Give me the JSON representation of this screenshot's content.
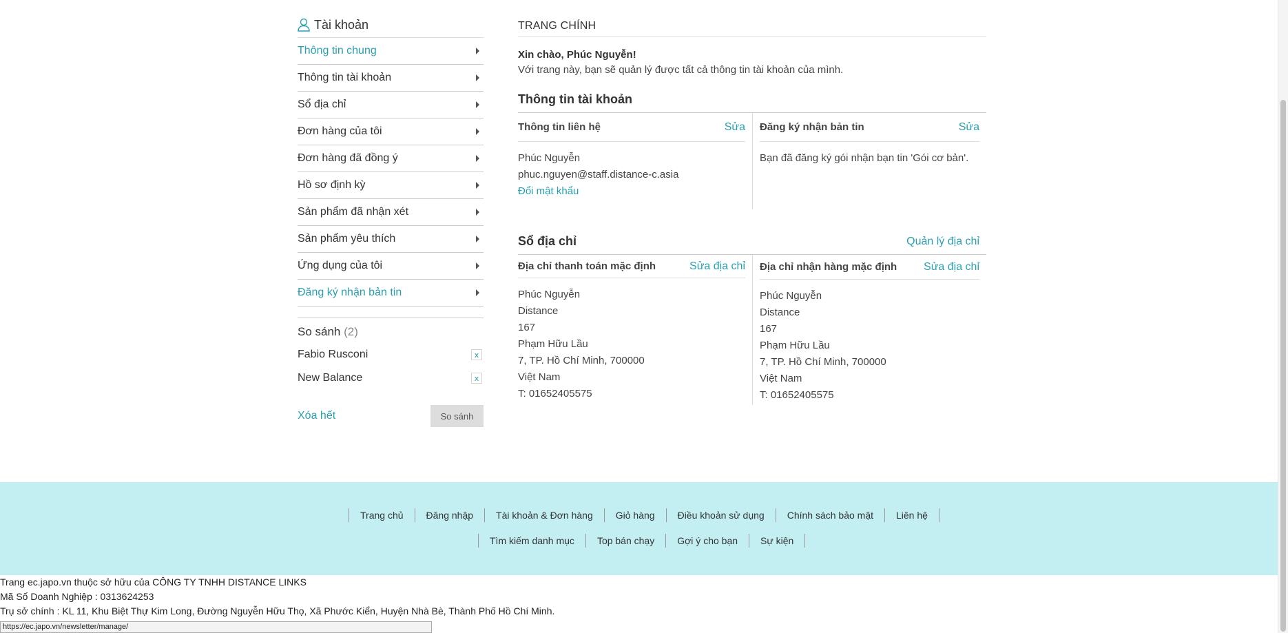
{
  "sidebar": {
    "title": "Tài khoản",
    "items": [
      {
        "label": "Thông tin chung",
        "active": true
      },
      {
        "label": "Thông tin tài khoản",
        "active": false
      },
      {
        "label": "Sổ địa chỉ",
        "active": false
      },
      {
        "label": "Đơn hàng của tôi",
        "active": false
      },
      {
        "label": "Đơn hàng đã đồng ý",
        "active": false
      },
      {
        "label": "Hồ sơ định kỳ",
        "active": false
      },
      {
        "label": "Sản phẩm đã nhận xét",
        "active": false
      },
      {
        "label": "Sản phẩm yêu thích",
        "active": false
      },
      {
        "label": "Ứng dụng của tôi",
        "active": false
      },
      {
        "label": "Đăng ký nhận bản tin",
        "active": true
      }
    ],
    "compare": {
      "title": "So sánh",
      "count": "(2)",
      "items": [
        "Fabio Rusconi",
        "New Balance"
      ],
      "remove_label": "x",
      "clear_label": "Xóa hết",
      "compare_button": "So sánh"
    }
  },
  "main": {
    "page_title": "TRANG CHÍNH",
    "greeting": "Xin chào, Phúc Nguyễn!",
    "greeting_sub": "Với trang này, bạn sẽ quản lý được tất cả thông tin tài khoản của mình.",
    "account_section": {
      "title": "Thông tin tài khoản",
      "contact": {
        "label": "Thông tin liên hệ",
        "edit": "Sửa",
        "name": "Phúc Nguyễn",
        "email": "phuc.nguyen@staff.distance-c.asia",
        "change_password": "Đổi mật khẩu"
      },
      "newsletter": {
        "label": "Đăng ký nhận bản tin",
        "edit": "Sửa",
        "text": "Bạn đã đăng ký gói nhận bạn tin 'Gói cơ bản'."
      }
    },
    "address_section": {
      "title": "Sổ địa chỉ",
      "manage": "Quản lý địa chỉ",
      "billing": {
        "label": "Địa chỉ thanh toán mặc định",
        "edit": "Sửa địa chỉ",
        "lines": [
          "Phúc Nguyễn",
          "Distance",
          "167",
          "Phạm Hữu Lầu",
          "7, TP. Hồ Chí Minh, 700000",
          "Việt Nam",
          "T: 01652405575"
        ]
      },
      "shipping": {
        "label": "Địa chỉ nhận hàng mặc định",
        "edit": "Sửa địa chỉ",
        "lines": [
          "Phúc Nguyễn",
          "Distance",
          "167",
          "Phạm Hữu Lầu",
          "7, TP. Hồ Chí Minh, 700000",
          "Việt Nam",
          "T: 01652405575"
        ]
      }
    }
  },
  "footer": {
    "row1": [
      "Trang chủ",
      "Đăng nhập",
      "Tài khoản & Đơn hàng",
      "Giỏ hàng",
      "Điều khoản sử dụng",
      "Chính sách bảo mật",
      "Liên hệ"
    ],
    "row2": [
      "Tìm kiếm danh mục",
      "Top bán chạy",
      "Gợi ý cho bạn",
      "Sự kiện"
    ],
    "info": [
      "Trang ec.japo.vn thuộc sở hữu của CÔNG TY TNHH DISTANCE LINKS",
      "Mã Số Doanh Nghiệp : 0313624253",
      "Trụ sở chính : KL 11, Khu Biệt Thự Kim Long, Đường Nguyễn Hữu Thọ, Xã Phước Kiển, Huyện Nhà Bè, Thành Phố Hồ Chí Minh."
    ]
  },
  "status_bar_url": "https://ec.japo.vn/newsletter/manage/",
  "colors": {
    "accent": "#2a9fb1",
    "footer_bg": "#c3eff2"
  }
}
